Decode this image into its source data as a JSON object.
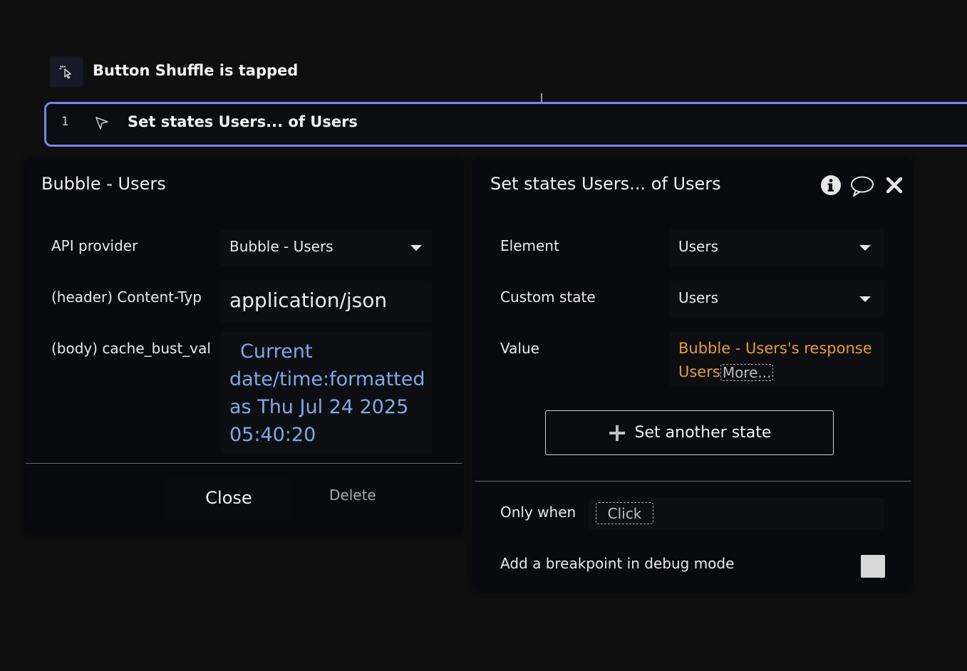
{
  "trigger": {
    "title": "Button Shuffle is tapped",
    "icon": "pointer-click-icon"
  },
  "step": {
    "number": "1",
    "title": "Set states Users... of Users",
    "icon": "cursor-arrow-icon",
    "accent": "#7b83e8"
  },
  "left_panel": {
    "title": "Bubble - Users",
    "fields": [
      {
        "label": "API provider",
        "value": "Bubble - Users"
      },
      {
        "label": "(header) Content-Typ",
        "value": "application/json"
      },
      {
        "label": "(body) cache_bust_val",
        "lines": [
          "Current",
          "date/time:formatted",
          "as Thu Jul 24 2025",
          "05:40:20"
        ]
      }
    ],
    "close_label": "Close",
    "delete_label": "Delete"
  },
  "right_panel": {
    "title": "Set states Users... of Users",
    "icons": [
      "info-icon",
      "comment-icon",
      "close-icon"
    ],
    "fields": [
      {
        "label": "Element",
        "value": "Users"
      },
      {
        "label": "Custom state",
        "value": "Users"
      },
      {
        "label": "Value",
        "line1": "Bubble - Users's response",
        "line2": "Users",
        "more": "More..."
      }
    ],
    "add_state_label": "Set another state",
    "only_when_label": "Only when",
    "only_when_placeholder": "Click",
    "breakpoint_label": "Add a breakpoint in debug mode"
  },
  "colors": {
    "dynamic_blue": "#7ea8e6",
    "dynamic_orange": "#e69c3b",
    "background": "#0f0f10"
  }
}
